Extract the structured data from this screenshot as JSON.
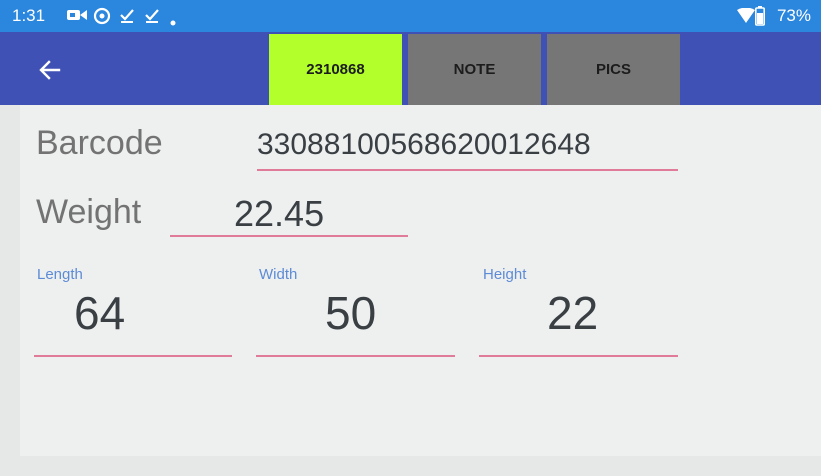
{
  "status_bar": {
    "time": "1:31",
    "battery": "73%",
    "icons": [
      "video-icon",
      "sync-icon",
      "download-done-icon",
      "download-done-icon",
      "dot-icon",
      "wifi-icon",
      "battery-icon"
    ]
  },
  "app_bar": {
    "back_icon": "arrow-left-icon",
    "tabs": [
      {
        "label": "2310868",
        "color": "#b2ff2c"
      },
      {
        "label": "NOTE",
        "color": "#767676"
      },
      {
        "label": "PICS",
        "color": "#767676"
      }
    ],
    "color": "#3f51b5"
  },
  "form": {
    "barcode_label": "Barcode",
    "barcode_value": "330881005686200126​48",
    "weight_label": "Weight",
    "weight_value": "22.45",
    "length_label": "Length",
    "length_value": "64",
    "width_label": "Width",
    "width_value": "50",
    "height_label": "Height",
    "height_value": "22",
    "underline_color": "#e07c99"
  }
}
